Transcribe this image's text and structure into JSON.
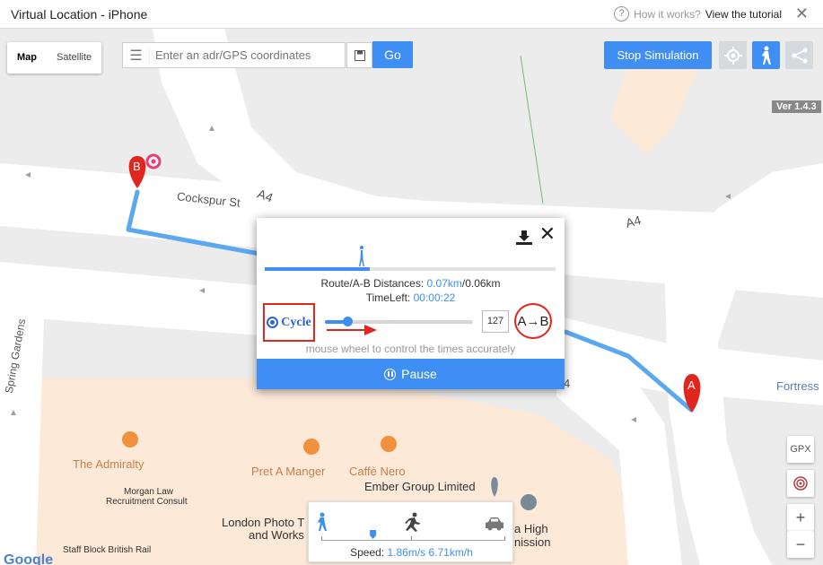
{
  "window": {
    "title": "Virtual Location - iPhone",
    "help_text": "How it works?",
    "tutorial_link": "View the tutorial",
    "help_glyph": "?",
    "close_glyph": "✕"
  },
  "map_type": {
    "map": "Map",
    "satellite": "Satellite"
  },
  "search": {
    "placeholder": "Enter an adr/GPS coordinates",
    "value": "",
    "list_glyph": "☰",
    "save_glyph": "💾",
    "go": "Go"
  },
  "toolbar": {
    "stop": "Stop Simulation",
    "icons": [
      "crosshair-icon",
      "walk-icon",
      "share-icon"
    ]
  },
  "version": "Ver 1.4.3",
  "map_labels": {
    "cockspur": "Cockspur St",
    "a4_1": "A4",
    "a4_2": "A4",
    "a4_3": "4",
    "spring": "Spring Gardens",
    "fortress": "Fortress",
    "admiralty": "The Admiralty",
    "pret": "Pret A Manger",
    "caffe": "Caffè Nero",
    "ember": "Ember Group Limited",
    "morgan1": "Morgan Law",
    "morgan2": "Recruitment Consult",
    "london1": "London Photo T",
    "london2": "and Works",
    "staff": "Staff Block British Rail",
    "high1": "a High",
    "high2": "nission",
    "google": "Google",
    "marker_a": "A",
    "marker_b": "B"
  },
  "panel": {
    "distance_label": "Route/A-B Distances: ",
    "distance_route": "0.07km",
    "distance_sep": "/",
    "distance_ab": "0.06km",
    "timeleft_label": "TimeLeft: ",
    "timeleft_value": "00:00:22",
    "cycle": "Cycle",
    "times": "127",
    "ab": "A→B",
    "hint": "mouse wheel to control the times accurately",
    "pause": "Pause",
    "close_glyph": "✕",
    "route_progress": 0.36,
    "times_slider": 0.15
  },
  "speed": {
    "label": "Speed: ",
    "value": "1.86m/s 6.71km/h",
    "slider": 0.28
  },
  "right_controls": {
    "gpx": "GPX",
    "zoom_in": "+",
    "zoom_out": "−"
  },
  "colors": {
    "accent": "#3f8ef3",
    "marker": "#e0271e",
    "route": "#5aa8f0",
    "highlight": "#e0271e"
  }
}
